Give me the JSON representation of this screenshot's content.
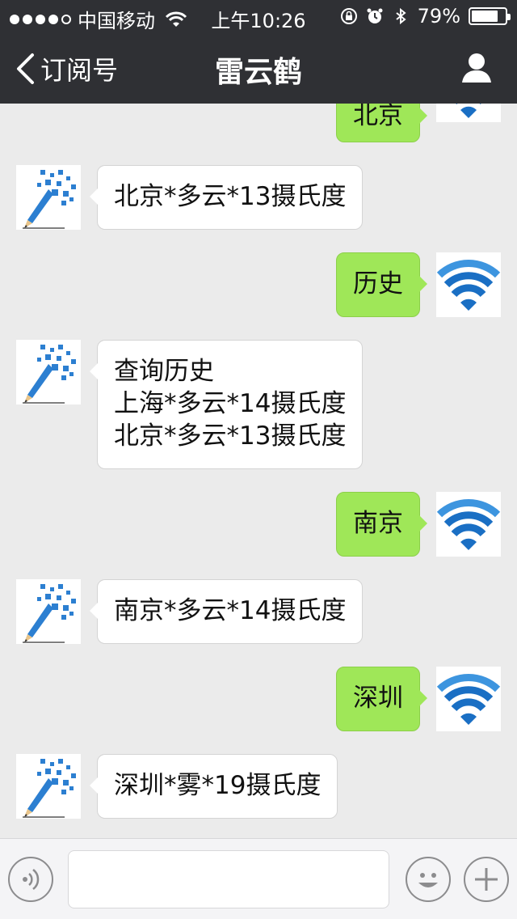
{
  "status_bar": {
    "carrier": "中国移动",
    "time": "上午10:26",
    "battery": "79%",
    "battery_level": 0.79
  },
  "nav": {
    "back_label": "订阅号",
    "title": "雷云鹤"
  },
  "messages": [
    {
      "side": "right",
      "text": "北京",
      "partial": true
    },
    {
      "side": "left",
      "text": "北京*多云*13摄氏度"
    },
    {
      "side": "right",
      "text": "历史"
    },
    {
      "side": "left",
      "text": "查询历史\n上海*多云*14摄氏度\n北京*多云*13摄氏度"
    },
    {
      "side": "right",
      "text": "南京"
    },
    {
      "side": "left",
      "text": "南京*多云*14摄氏度"
    },
    {
      "side": "right",
      "text": "深圳"
    },
    {
      "side": "left",
      "text": "深圳*雾*19摄氏度"
    }
  ],
  "icons": {
    "back": "chevron-left-icon",
    "profile": "person-icon",
    "user_avatar": "wifi-icon",
    "bot_avatar": "pencil-letters-icon",
    "voice": "voice-icon",
    "emoji": "smiley-icon",
    "plus": "plus-icon"
  },
  "colors": {
    "nav_bg": "#2f3034",
    "chat_bg": "#ebebeb",
    "outgoing_bubble": "#9fe758",
    "incoming_bubble": "#ffffff",
    "wifi_blue": "#1a6fc4"
  },
  "input": {
    "value": "",
    "placeholder": ""
  }
}
